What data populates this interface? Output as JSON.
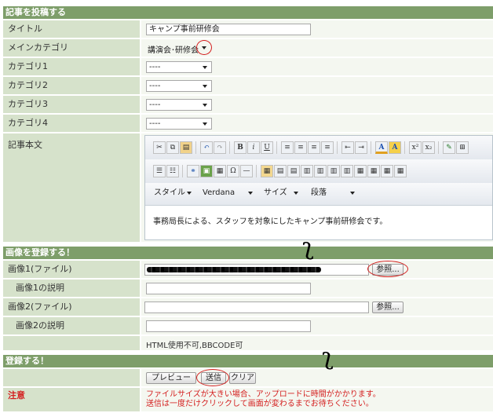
{
  "post_section": {
    "header": "記事を投稿する",
    "title_label": "タイトル",
    "title_value": "キャンプ事前研修会",
    "main_category_label": "メインカテゴリ",
    "main_category_value": "講演会･研修会",
    "category1_label": "カテゴリ1",
    "category2_label": "カテゴリ2",
    "category3_label": "カテゴリ3",
    "category4_label": "カテゴリ4",
    "category_placeholder": "----",
    "body_label": "記事本文",
    "editor": {
      "style_label": "スタイル",
      "font_label": "Verdana",
      "size_label": "サイズ",
      "paragraph_label": "段落",
      "content": "事務局長による、スタッフを対象にしたキャンプ事前研修会です。",
      "toolbar_bold": "B",
      "toolbar_italic": "i",
      "toolbar_underline": "U",
      "toolbar_super": "x²",
      "toolbar_sub": "x₂",
      "toolbar_color_a": "A"
    }
  },
  "image_section": {
    "header": "画像を登録する！",
    "image1_label": "画像1(ファイル)",
    "image1_desc_label": "画像1の説明",
    "image2_label": "画像2(ファイル)",
    "image2_desc_label": "画像2の説明",
    "browse_label": "参照...",
    "note": "HTML使用不可,BBCODE可"
  },
  "submit_section": {
    "header": "登録する！",
    "preview_label": "プレビュー",
    "send_label": "送信",
    "clear_label": "クリア",
    "caution_label": "注意",
    "caution_line1": "ファイルサイズが大きい場合、アップロードに時間がかかります。",
    "caution_line2": "送信は一度だけクリックして画面が変わるまでお待ちください。"
  },
  "colors": {
    "header_bg": "#7e9e6a",
    "label_bg": "#d6e2cb",
    "value_bg": "#f4f7f0",
    "annotation_red": "#d42020",
    "caution_red": "#d42020"
  }
}
